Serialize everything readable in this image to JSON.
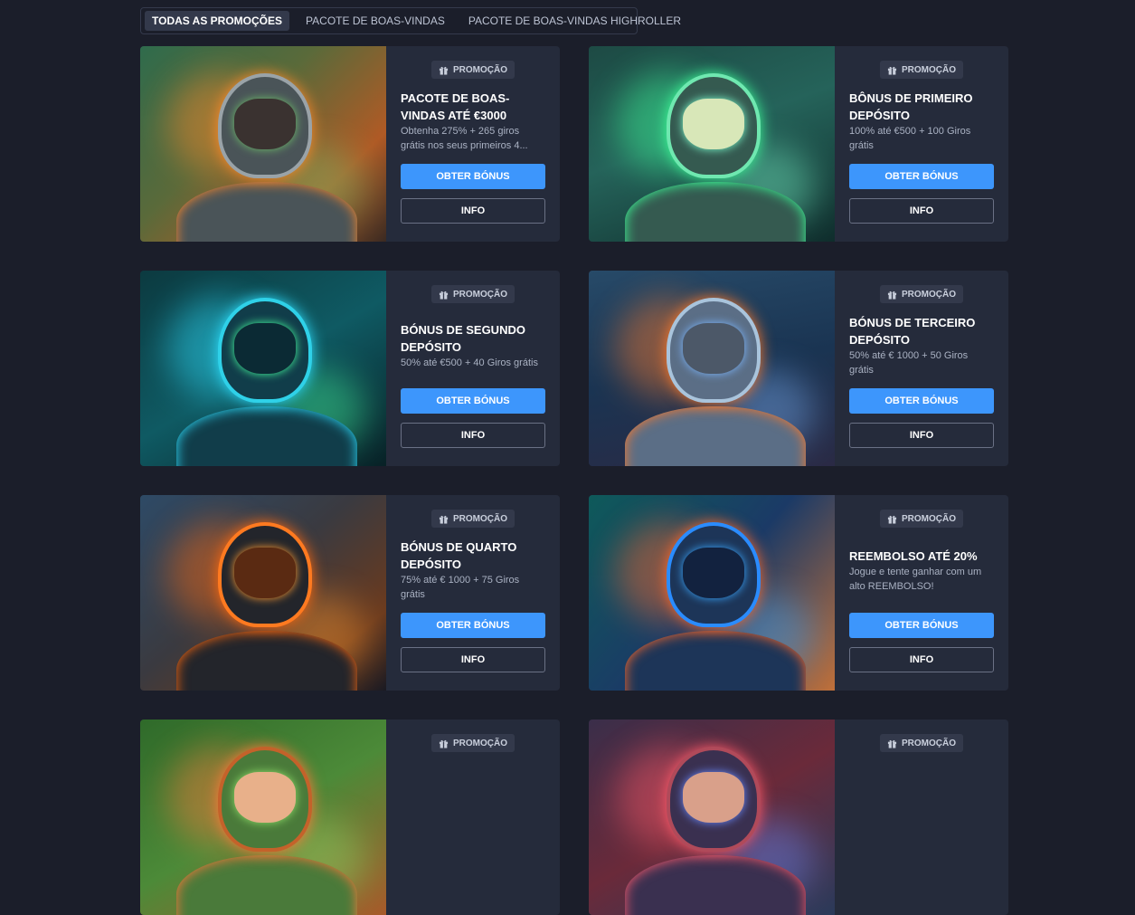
{
  "tabs": [
    {
      "label": "TODAS AS PROMOÇÕES",
      "active": true
    },
    {
      "label": "PACOTE DE BOAS-VINDAS",
      "active": false
    },
    {
      "label": "PACOTE DE BOAS-VINDAS HIGHROLLER",
      "active": false
    }
  ],
  "badge_label": "PROMOÇÃO",
  "cards": [
    {
      "title": "PACOTE DE BOAS-VINDAS ATÉ €3000",
      "desc": "Obtenha 275% + 265 giros grátis nos seus primeiros 4...",
      "cta": "OBTER BÓNUS",
      "info": "INFO",
      "theme": "orange-green"
    },
    {
      "title": "BÔNUS DE PRIMEIRO DEPÓSITO",
      "desc": "100% até €500 + 100 Giros grátis",
      "cta": "OBTER BÓNUS",
      "info": "INFO",
      "theme": "green"
    },
    {
      "title": "BÓNUS DE SEGUNDO DEPÓSITO",
      "desc": "50% até €500 + 40 Giros grátis",
      "cta": "OBTER BÓNUS",
      "info": "INFO",
      "theme": "teal"
    },
    {
      "title": "BÓNUS DE TERCEIRO DEPÓSITO",
      "desc": "50% até € 1000 + 50 Giros grátis",
      "cta": "OBTER BÓNUS",
      "info": "INFO",
      "theme": "blue-orange"
    },
    {
      "title": "BÓNUS DE QUARTO DEPÓSITO",
      "desc": "75% até € 1000 + 75 Giros grátis",
      "cta": "OBTER BÓNUS",
      "info": "INFO",
      "theme": "fire"
    },
    {
      "title": "REEMBOLSO ATÉ 20%",
      "desc": "Jogue e tente ganhar com um alto REEMBOLSO!",
      "cta": "OBTER BÓNUS",
      "info": "INFO",
      "theme": "neon-blue"
    },
    {
      "title": "",
      "desc": "",
      "cta": "",
      "info": "",
      "theme": "redhead"
    },
    {
      "title": "",
      "desc": "",
      "cta": "",
      "info": "",
      "theme": "group"
    }
  ],
  "colors": {
    "accent": "#3d96fc",
    "background": "#1b1e2a",
    "card": "#252b3b"
  }
}
